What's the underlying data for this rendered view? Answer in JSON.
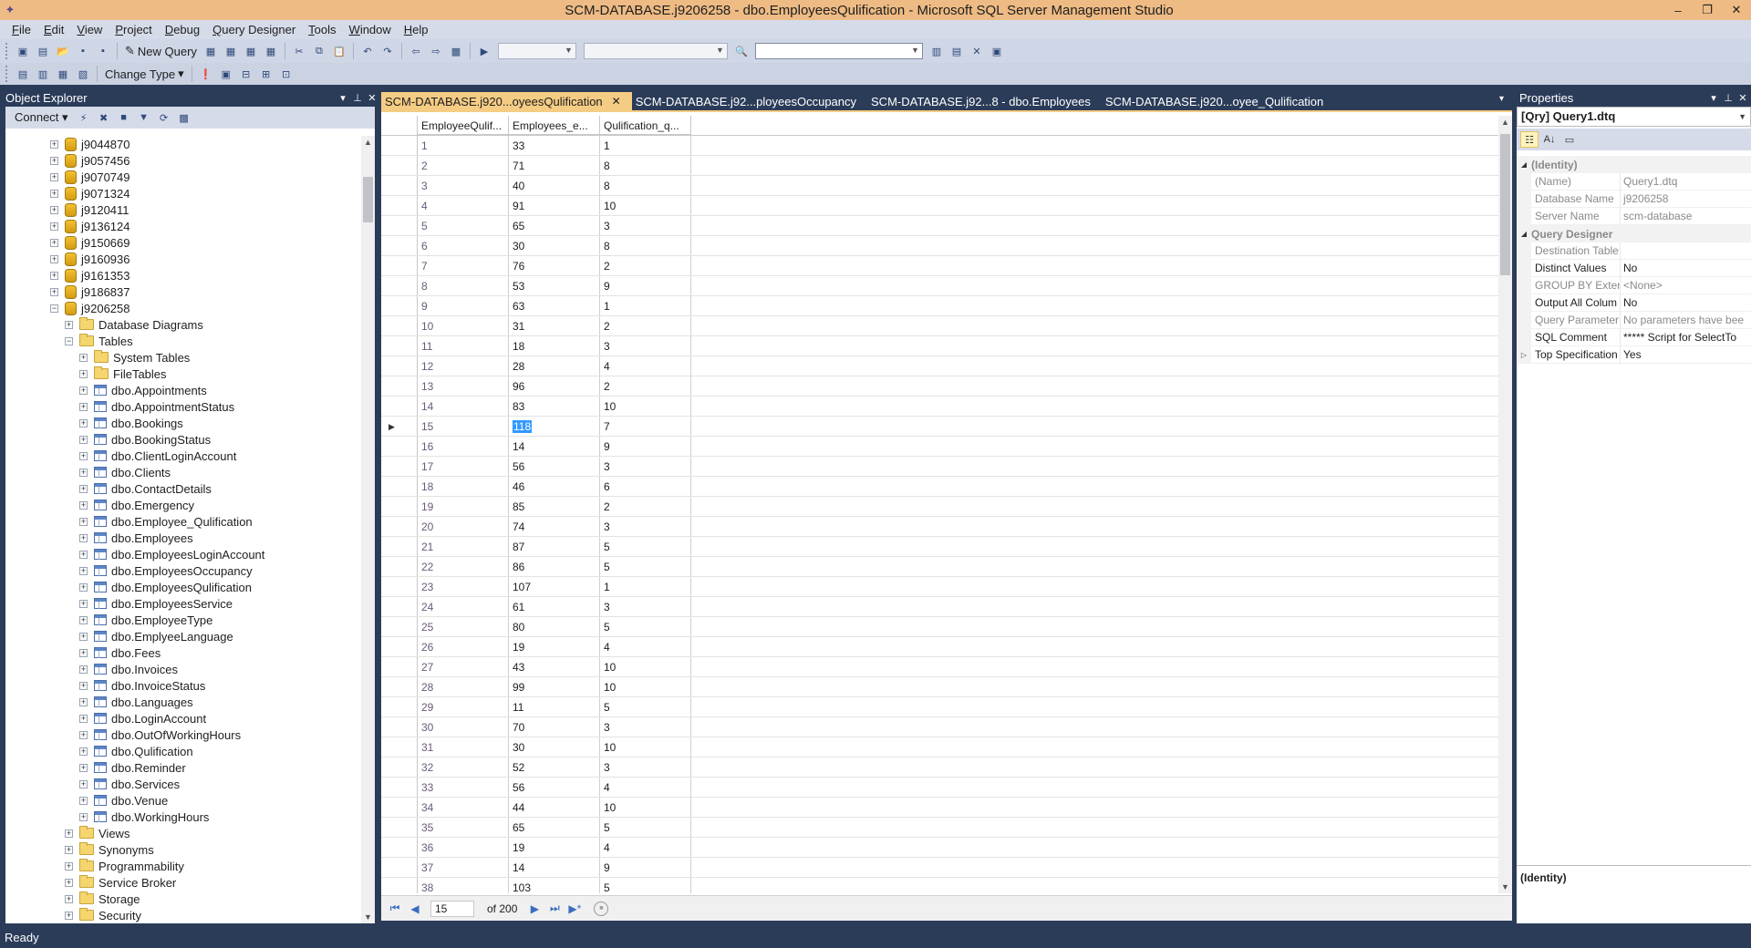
{
  "window": {
    "title": "SCM-DATABASE.j9206258 - dbo.EmployeesQulification - Microsoft SQL Server Management Studio",
    "minimize": "–",
    "restore": "❐",
    "close": "✕"
  },
  "menu": [
    "File",
    "Edit",
    "View",
    "Project",
    "Debug",
    "Query Designer",
    "Tools",
    "Window",
    "Help"
  ],
  "toolbar": {
    "new_query": "New Query",
    "change_type": "Change Type"
  },
  "object_explorer": {
    "title": "Object Explorer",
    "connect": "Connect",
    "nodes": [
      {
        "label": "j9044870",
        "exp": "+",
        "icon": "db",
        "indent": 0
      },
      {
        "label": "j9057456",
        "exp": "+",
        "icon": "db",
        "indent": 0
      },
      {
        "label": "j9070749",
        "exp": "+",
        "icon": "db",
        "indent": 0
      },
      {
        "label": "j9071324",
        "exp": "+",
        "icon": "db",
        "indent": 0
      },
      {
        "label": "j9120411",
        "exp": "+",
        "icon": "db",
        "indent": 0
      },
      {
        "label": "j9136124",
        "exp": "+",
        "icon": "db",
        "indent": 0
      },
      {
        "label": "j9150669",
        "exp": "+",
        "icon": "db",
        "indent": 0
      },
      {
        "label": "j9160936",
        "exp": "+",
        "icon": "db",
        "indent": 0
      },
      {
        "label": "j9161353",
        "exp": "+",
        "icon": "db",
        "indent": 0
      },
      {
        "label": "j9186837",
        "exp": "+",
        "icon": "db",
        "indent": 0
      },
      {
        "label": "j9206258",
        "exp": "−",
        "icon": "db",
        "indent": 0
      },
      {
        "label": "Database Diagrams",
        "exp": "+",
        "icon": "folder",
        "indent": 1
      },
      {
        "label": "Tables",
        "exp": "−",
        "icon": "folder",
        "indent": 1
      },
      {
        "label": "System Tables",
        "exp": "+",
        "icon": "folder",
        "indent": 2
      },
      {
        "label": "FileTables",
        "exp": "+",
        "icon": "folder",
        "indent": 2
      },
      {
        "label": "dbo.Appointments",
        "exp": "+",
        "icon": "table",
        "indent": 2
      },
      {
        "label": "dbo.AppointmentStatus",
        "exp": "+",
        "icon": "table",
        "indent": 2
      },
      {
        "label": "dbo.Bookings",
        "exp": "+",
        "icon": "table",
        "indent": 2
      },
      {
        "label": "dbo.BookingStatus",
        "exp": "+",
        "icon": "table",
        "indent": 2
      },
      {
        "label": "dbo.ClientLoginAccount",
        "exp": "+",
        "icon": "table",
        "indent": 2
      },
      {
        "label": "dbo.Clients",
        "exp": "+",
        "icon": "table",
        "indent": 2
      },
      {
        "label": "dbo.ContactDetails",
        "exp": "+",
        "icon": "table",
        "indent": 2
      },
      {
        "label": "dbo.Emergency",
        "exp": "+",
        "icon": "table",
        "indent": 2
      },
      {
        "label": "dbo.Employee_Qulification",
        "exp": "+",
        "icon": "table",
        "indent": 2
      },
      {
        "label": "dbo.Employees",
        "exp": "+",
        "icon": "table",
        "indent": 2
      },
      {
        "label": "dbo.EmployeesLoginAccount",
        "exp": "+",
        "icon": "table",
        "indent": 2
      },
      {
        "label": "dbo.EmployeesOccupancy",
        "exp": "+",
        "icon": "table",
        "indent": 2
      },
      {
        "label": "dbo.EmployeesQulification",
        "exp": "+",
        "icon": "table",
        "indent": 2
      },
      {
        "label": "dbo.EmployeesService",
        "exp": "+",
        "icon": "table",
        "indent": 2
      },
      {
        "label": "dbo.EmployeeType",
        "exp": "+",
        "icon": "table",
        "indent": 2
      },
      {
        "label": "dbo.EmplyeeLanguage",
        "exp": "+",
        "icon": "table",
        "indent": 2
      },
      {
        "label": "dbo.Fees",
        "exp": "+",
        "icon": "table",
        "indent": 2
      },
      {
        "label": "dbo.Invoices",
        "exp": "+",
        "icon": "table",
        "indent": 2
      },
      {
        "label": "dbo.InvoiceStatus",
        "exp": "+",
        "icon": "table",
        "indent": 2
      },
      {
        "label": "dbo.Languages",
        "exp": "+",
        "icon": "table",
        "indent": 2
      },
      {
        "label": "dbo.LoginAccount",
        "exp": "+",
        "icon": "table",
        "indent": 2
      },
      {
        "label": "dbo.OutOfWorkingHours",
        "exp": "+",
        "icon": "table",
        "indent": 2
      },
      {
        "label": "dbo.Qulification",
        "exp": "+",
        "icon": "table",
        "indent": 2
      },
      {
        "label": "dbo.Reminder",
        "exp": "+",
        "icon": "table",
        "indent": 2
      },
      {
        "label": "dbo.Services",
        "exp": "+",
        "icon": "table",
        "indent": 2
      },
      {
        "label": "dbo.Venue",
        "exp": "+",
        "icon": "table",
        "indent": 2
      },
      {
        "label": "dbo.WorkingHours",
        "exp": "+",
        "icon": "table",
        "indent": 2
      },
      {
        "label": "Views",
        "exp": "+",
        "icon": "folder",
        "indent": 1
      },
      {
        "label": "Synonyms",
        "exp": "+",
        "icon": "folder",
        "indent": 1
      },
      {
        "label": "Programmability",
        "exp": "+",
        "icon": "folder",
        "indent": 1
      },
      {
        "label": "Service Broker",
        "exp": "+",
        "icon": "folder",
        "indent": 1
      },
      {
        "label": "Storage",
        "exp": "+",
        "icon": "folder",
        "indent": 1
      },
      {
        "label": "Security",
        "exp": "+",
        "icon": "folder",
        "indent": 1
      }
    ]
  },
  "tabs": [
    {
      "label": "SCM-DATABASE.j920...oyeesQulification",
      "active": true
    },
    {
      "label": "SCM-DATABASE.j92...ployeesOccupancy",
      "active": false
    },
    {
      "label": "SCM-DATABASE.j92...8 - dbo.Employees",
      "active": false
    },
    {
      "label": "SCM-DATABASE.j920...oyee_Qulification",
      "active": false
    }
  ],
  "grid": {
    "columns": [
      "EmployeeQulif...",
      "Employees_e...",
      "Qulification_q..."
    ],
    "selected_row": 15,
    "rows": [
      [
        "1",
        "33",
        "1"
      ],
      [
        "2",
        "71",
        "8"
      ],
      [
        "3",
        "40",
        "8"
      ],
      [
        "4",
        "91",
        "10"
      ],
      [
        "5",
        "65",
        "3"
      ],
      [
        "6",
        "30",
        "8"
      ],
      [
        "7",
        "76",
        "2"
      ],
      [
        "8",
        "53",
        "9"
      ],
      [
        "9",
        "63",
        "1"
      ],
      [
        "10",
        "31",
        "2"
      ],
      [
        "11",
        "18",
        "3"
      ],
      [
        "12",
        "28",
        "4"
      ],
      [
        "13",
        "96",
        "2"
      ],
      [
        "14",
        "83",
        "10"
      ],
      [
        "15",
        "118",
        "7"
      ],
      [
        "16",
        "14",
        "9"
      ],
      [
        "17",
        "56",
        "3"
      ],
      [
        "18",
        "46",
        "6"
      ],
      [
        "19",
        "85",
        "2"
      ],
      [
        "20",
        "74",
        "3"
      ],
      [
        "21",
        "87",
        "5"
      ],
      [
        "22",
        "86",
        "5"
      ],
      [
        "23",
        "107",
        "1"
      ],
      [
        "24",
        "61",
        "3"
      ],
      [
        "25",
        "80",
        "5"
      ],
      [
        "26",
        "19",
        "4"
      ],
      [
        "27",
        "43",
        "10"
      ],
      [
        "28",
        "99",
        "10"
      ],
      [
        "29",
        "11",
        "5"
      ],
      [
        "30",
        "70",
        "3"
      ],
      [
        "31",
        "30",
        "10"
      ],
      [
        "32",
        "52",
        "3"
      ],
      [
        "33",
        "56",
        "4"
      ],
      [
        "34",
        "44",
        "10"
      ],
      [
        "35",
        "65",
        "5"
      ],
      [
        "36",
        "19",
        "4"
      ],
      [
        "37",
        "14",
        "9"
      ],
      [
        "38",
        "103",
        "5"
      ]
    ]
  },
  "record_nav": {
    "current": "15",
    "of_label": "of 200"
  },
  "properties": {
    "title": "Properties",
    "object": "[Qry] Query1.dtq",
    "items": [
      {
        "type": "cat",
        "name": "(Identity)",
        "exp": "◢"
      },
      {
        "type": "row",
        "name": "(Name)",
        "value": "Query1.dtq",
        "ro": true
      },
      {
        "type": "row",
        "name": "Database Name",
        "value": "j9206258",
        "ro": true
      },
      {
        "type": "row",
        "name": "Server Name",
        "value": "scm-database",
        "ro": true
      },
      {
        "type": "cat",
        "name": "Query Designer",
        "exp": "◢"
      },
      {
        "type": "row",
        "name": "Destination Table",
        "value": "",
        "ro": true
      },
      {
        "type": "row",
        "name": "Distinct Values",
        "value": "No",
        "ro": false
      },
      {
        "type": "row",
        "name": "GROUP BY Extensi",
        "value": "<None>",
        "ro": true
      },
      {
        "type": "row",
        "name": "Output All Colum",
        "value": "No",
        "ro": false
      },
      {
        "type": "row",
        "name": "Query Parameter l",
        "value": "No parameters have bee",
        "ro": true
      },
      {
        "type": "row",
        "name": "SQL Comment",
        "value": "***** Script for SelectTo",
        "ro": false
      },
      {
        "type": "row",
        "name": "Top Specification",
        "value": "Yes",
        "ro": false,
        "gut": "▷"
      }
    ],
    "description_title": "(Identity)"
  },
  "status": "Ready"
}
